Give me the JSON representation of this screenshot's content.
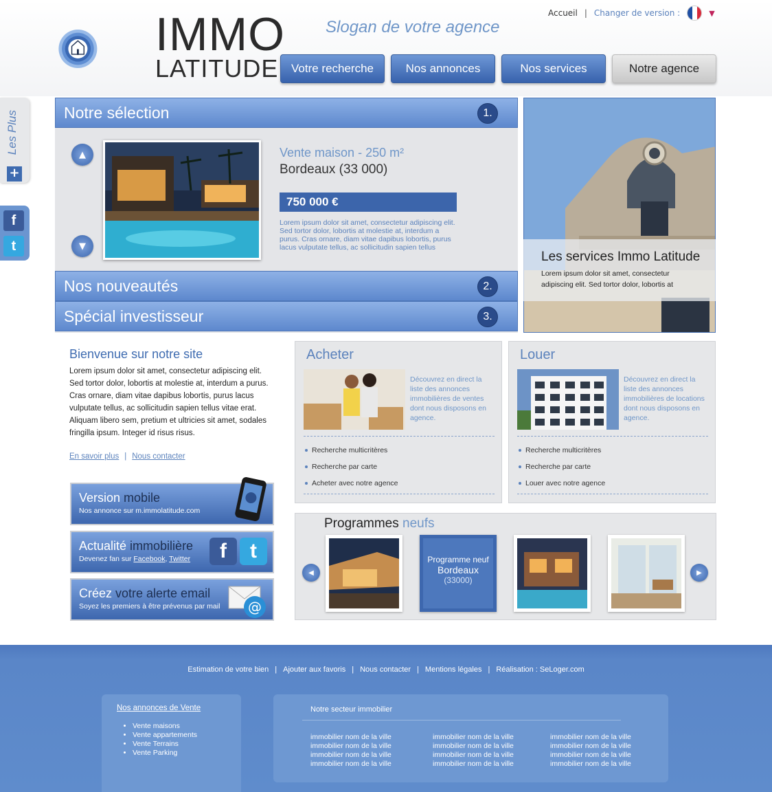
{
  "header": {
    "logo_line1": "IMMO",
    "logo_line2": "LATITUDE",
    "slogan": "Slogan de votre agence",
    "top_links": {
      "home": "Accueil",
      "separator": "|",
      "version": "Changer de version :"
    },
    "nav": [
      "Votre recherche",
      "Nos annonces",
      "Nos services",
      "Notre agence"
    ],
    "active_nav": "Notre agence"
  },
  "side": {
    "plus_label": "Les Plus",
    "plus_icon": "+",
    "facebook_icon": "f",
    "twitter_icon": "t"
  },
  "selection": {
    "tabs": [
      {
        "label": "Notre sélection",
        "number": "1."
      },
      {
        "label": "Nos nouveautés",
        "number": "2."
      },
      {
        "label": "Spécial investisseur",
        "number": "3."
      }
    ],
    "title": "Vente maison - 250 m²",
    "city": "Bordeaux (33 000)",
    "price": "750 000 €",
    "description": "Lorem ipsum dolor sit amet, consectetur adipiscing elit. Sed tortor dolor, lobortis at molestie at, interdum a purus. Cras ornare, diam vitae dapibus lobortis, purus lacus vulputate tellus, ac sollicitudin sapien tellus"
  },
  "services_panel": {
    "title": "Les services Immo Latitude",
    "text": "Lorem ipsum dolor sit amet, consectetur adipiscing elit. Sed tortor dolor, lobortis at"
  },
  "welcome": {
    "title": "Bienvenue sur notre site",
    "text": "Lorem ipsum dolor sit amet, consectetur adipiscing elit. Sed tortor dolor, lobortis at molestie at, interdum a purus. Cras ornare, diam vitae dapibus lobortis, purus lacus vulputate tellus, ac sollicitudin sapien tellus vitae erat. Aliquam libero sem, pretium et ultricies sit amet, sodales fringilla ipsum. Integer id risus risus.",
    "link_more": "En savoir plus",
    "link_sep": "|",
    "link_contact": "Nous contacter"
  },
  "promos": [
    {
      "title_a": "Version ",
      "title_b": "mobile",
      "sub": "Nos annonce sur m.immolatitude.com"
    },
    {
      "title_a": "Actualité ",
      "title_b": "immobilière",
      "sub_a": "Devenez fan sur ",
      "sub_fb": "Facebook",
      "sub_comma": ", ",
      "sub_tw": "Twitter"
    },
    {
      "title_a": "Créez ",
      "title_b": "votre alerte email",
      "sub": "Soyez les premiers à être prévenus par mail"
    }
  ],
  "acheter": {
    "title": "Acheter",
    "desc": "Découvrez en direct la liste des annonces immobilières de ventes dont nous disposons en agence.",
    "items": [
      "Recherche multicritères",
      "Recherche par carte",
      "Acheter avec notre agence"
    ]
  },
  "louer": {
    "title": "Louer",
    "desc": "Découvrez en direct la liste des annonces immobilières de locations dont nous disposons en agence.",
    "items": [
      "Recherche multicritères",
      "Recherche par carte",
      "Louer avec notre agence"
    ]
  },
  "programmes": {
    "title_a": "Programmes ",
    "title_b": "neufs",
    "active_line1": "Programme neuf",
    "active_line2": "Bordeaux",
    "active_line3": "(33000)"
  },
  "footer": {
    "links": [
      "Estimation de votre bien",
      "Ajouter aux favoris",
      "Nous contacter",
      "Mentions légales",
      "Réalisation : SeLoger.com"
    ],
    "sep": "|",
    "box1_title": "Nos annonces de Vente",
    "box1_items": [
      "Vente maisons",
      "Vente appartements",
      "Vente Terrains",
      "Vente Parking"
    ],
    "box2_title": "Notre secteur immobilier",
    "box2_item": "immobilier nom de la ville"
  },
  "colors": {
    "accent": "#3e6bb0",
    "light_blue": "#6f96c8",
    "footer": "#5f8ccc"
  }
}
